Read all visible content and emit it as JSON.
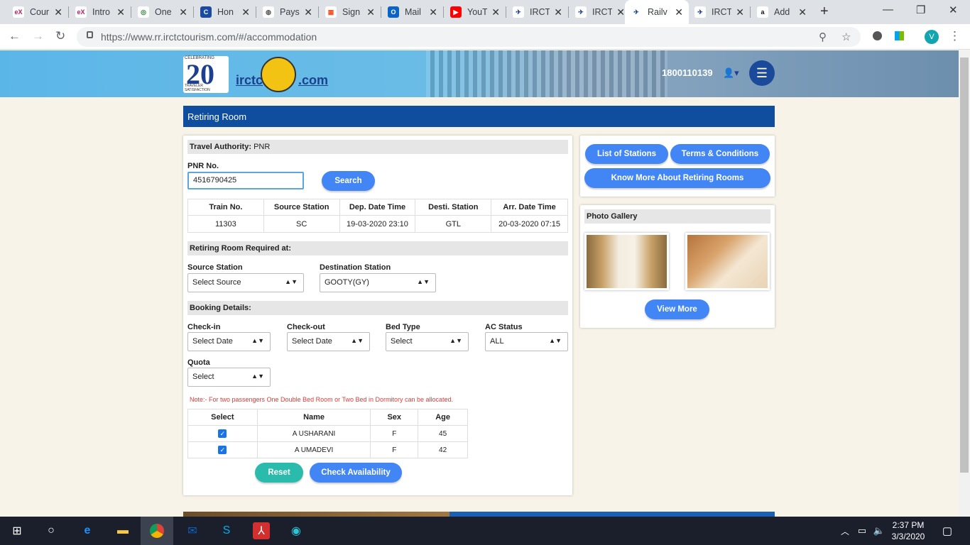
{
  "browser": {
    "tabs": [
      {
        "title": "Cour",
        "favicon": "edx-icon",
        "color": "#ffffff",
        "fg": "#c2185b",
        "glyph": "eX"
      },
      {
        "title": "Intro",
        "favicon": "edx-icon",
        "color": "#ffffff",
        "fg": "#c2185b",
        "glyph": "eX"
      },
      {
        "title": "One",
        "favicon": "one-icon",
        "color": "#ffffff",
        "fg": "#2e7d32",
        "glyph": "◎"
      },
      {
        "title": "Hon",
        "favicon": "coursera-icon",
        "color": "#1a4ba0",
        "fg": "#ffffff",
        "glyph": "C"
      },
      {
        "title": "Pays",
        "favicon": "globe-icon",
        "color": "#ffffff",
        "fg": "#555555",
        "glyph": "◍"
      },
      {
        "title": "Sign",
        "favicon": "microsoft-icon",
        "color": "#ffffff",
        "fg": "#f25022",
        "glyph": "▦"
      },
      {
        "title": "Mail",
        "favicon": "outlook-icon",
        "color": "#0a64c8",
        "fg": "#ffffff",
        "glyph": "O"
      },
      {
        "title": "YouT",
        "favicon": "youtube-icon",
        "color": "#ff0000",
        "fg": "#ffffff",
        "glyph": "▶"
      },
      {
        "title": "IRCT",
        "favicon": "irctc-icon",
        "color": "#ffffff",
        "fg": "#1c3f8f",
        "glyph": "✈"
      },
      {
        "title": "IRCT",
        "favicon": "irctc-icon",
        "color": "#ffffff",
        "fg": "#1c3f8f",
        "glyph": "✈"
      },
      {
        "title": "Railv",
        "favicon": "irctc-icon",
        "color": "#ffffff",
        "fg": "#1c3f8f",
        "glyph": "✈",
        "active": true
      },
      {
        "title": "IRCT",
        "favicon": "irctc-icon",
        "color": "#ffffff",
        "fg": "#1c3f8f",
        "glyph": "✈"
      },
      {
        "title": "Add",
        "favicon": "amazon-icon",
        "color": "#ffffff",
        "fg": "#111111",
        "glyph": "a"
      }
    ],
    "url_host": "https://www.rr.irctctourism.com",
    "url_path": "/#/accommodation",
    "profile_initial": "V"
  },
  "header": {
    "logo_top": "CELEBRATING",
    "logo_number": "20",
    "logo_bottom": "TRAVELER SATISFACTION",
    "brand_left": "irctc",
    "brand_right": ".com",
    "phone": "1800110139"
  },
  "page_title": "Retiring Room",
  "travel": {
    "authority_label": "Travel Authority:",
    "authority_value": "PNR",
    "pnr_label": "PNR No.",
    "pnr_value": "4516790425",
    "search_button": "Search"
  },
  "train_table": {
    "headers": [
      "Train No.",
      "Source Station",
      "Dep. Date Time",
      "Desti. Station",
      "Arr. Date Time"
    ],
    "row": [
      "11303",
      "SC",
      "19-03-2020 23:10",
      "GTL",
      "20-03-2020 07:15"
    ]
  },
  "required_at": {
    "heading": "Retiring Room Required at:",
    "source_label": "Source Station",
    "source_value": "Select Source",
    "dest_label": "Destination Station",
    "dest_value": "GOOTY(GY)"
  },
  "booking": {
    "heading": "Booking Details:",
    "checkin_label": "Check-in",
    "checkin_value": "Select Date",
    "checkout_label": "Check-out",
    "checkout_value": "Select Date",
    "bed_label": "Bed Type",
    "bed_value": "Select",
    "ac_label": "AC Status",
    "ac_value": "ALL",
    "quota_label": "Quota",
    "quota_value": "Select",
    "note": "Note:- For two passengers One Double Bed Room or Two Bed in Dormitory can be allocated."
  },
  "passengers": {
    "headers": [
      "Select",
      "Name",
      "Sex",
      "Age"
    ],
    "rows": [
      {
        "name": "A USHARANI",
        "sex": "F",
        "age": "45",
        "checked": true
      },
      {
        "name": "A UMADEVI",
        "sex": "F",
        "age": "42",
        "checked": true
      }
    ]
  },
  "actions": {
    "reset": "Reset",
    "check": "Check Availability"
  },
  "sidebar": {
    "list_stations": "List of Stations",
    "terms": "Terms & Conditions",
    "know_more": "Know More About Retiring Rooms",
    "gallery_heading": "Photo Gallery",
    "view_more": "View More"
  },
  "taskbar": {
    "time": "2:37 PM",
    "date": "3/3/2020"
  }
}
